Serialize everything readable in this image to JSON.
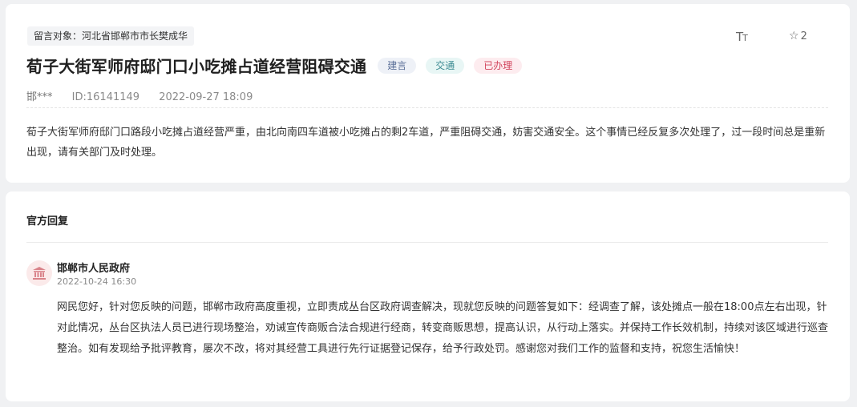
{
  "message": {
    "target_label": "留言对象：河北省邯郸市市长樊成华",
    "font_size_icon": "text-size-icon",
    "favorite_icon": "star-outline-icon",
    "favorite_count": "2",
    "title": "荀子大街军师府邸门口小吃摊占道经营阻碍交通",
    "tags": [
      "建言",
      "交通",
      "已办理"
    ],
    "tag_colors": {
      "建言": "#5a6f98",
      "交通": "#3c8b92",
      "已办理": "#d2455d"
    },
    "author": "邯***",
    "id": "ID:16141149",
    "datetime": "2022-09-27 18:09",
    "content": "荀子大街军师府邸门口路段小吃摊占道经营严重，由北向南四车道被小吃摊占的剩2车道，严重阻碍交通，妨害交通安全。这个事情已经反复多次处理了，过一段时间总是重新出现，请有关部门及时处理。"
  },
  "reply": {
    "heading": "官方回复",
    "org_icon": "government-building-icon",
    "org_name": "邯郸市人民政府",
    "date": "2022-10-24 16:30",
    "body": "网民您好，针对您反映的问题，邯郸市政府高度重视，立即责成丛台区政府调查解决，现就您反映的问题答复如下：经调查了解，该处摊点一般在18:00点左右出现，针对此情况，丛台区执法人员已进行现场整治，劝诫宣传商贩合法合规进行经商，转变商贩思想，提高认识，从行动上落实。并保持工作长效机制，持续对该区域进行巡查整治。如有发现给予批评教育，屡次不改，将对其经营工具进行先行证据登记保存，给予行政处罚。感谢您对我们工作的监督和支持，祝您生活愉快！"
  }
}
